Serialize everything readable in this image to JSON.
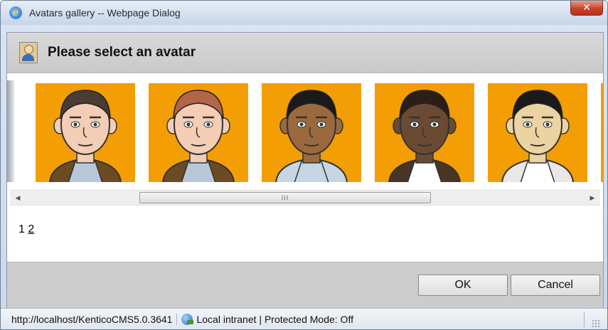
{
  "window": {
    "title": "Avatars gallery -- Webpage Dialog",
    "close_glyph": "✕",
    "ie_glyph": "e"
  },
  "header": {
    "title": "Please select an avatar",
    "icon": "avatar-user-icon"
  },
  "gallery": {
    "background_color": "#f39e05",
    "avatars": [
      {
        "icon": "avatar-dark-hair-man",
        "hair": "#4a3c34",
        "skin": "#f3cdb5",
        "shirt": "#b9c8d8",
        "jacket": "#6b4a24"
      },
      {
        "icon": "avatar-red-hair-man",
        "hair": "#b46548",
        "skin": "#f3cdb5",
        "shirt": "#b9c8d8",
        "jacket": "#6b4a24"
      },
      {
        "icon": "avatar-black-hair-man",
        "hair": "#1a1a1a",
        "skin": "#9a6a3e",
        "shirt": "#c7d6e4",
        "jacket": "#c7d6e4"
      },
      {
        "icon": "avatar-bald-goatee-man",
        "hair": "#2a1e18",
        "skin": "#6b4a33",
        "shirt": "#ffffff",
        "jacket": "#4a3424"
      },
      {
        "icon": "avatar-long-hair-man",
        "hair": "#1a1a1a",
        "skin": "#ecd3a2",
        "shirt": "#ffffff",
        "jacket": "#e8e8e8"
      }
    ]
  },
  "scrollbar": {
    "left_arrow": "◀",
    "right_arrow": "▶",
    "thumb_grip": "III"
  },
  "pager": {
    "current": "1",
    "link": "2"
  },
  "buttons": {
    "ok": "OK",
    "cancel": "Cancel"
  },
  "statusbar": {
    "url": "http://localhost/KenticoCMS5.0.3641",
    "zone": "Local intranet | Protected Mode: Off",
    "zone_icon": "globe-icon"
  }
}
